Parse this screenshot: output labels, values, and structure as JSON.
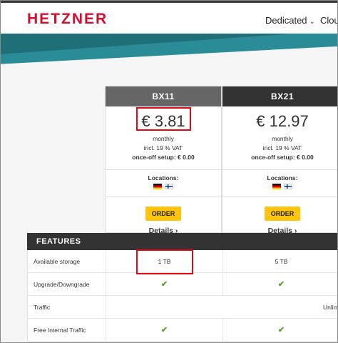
{
  "header": {
    "logo": "HETZNER",
    "nav": [
      {
        "label": "Dedicated",
        "chevron": "⌄"
      },
      {
        "label": "Clou"
      }
    ]
  },
  "products": [
    {
      "name": "BX11",
      "price": "€ 3.81",
      "period": "monthly",
      "vat": "incl. 19 % VAT",
      "setup": "once-off setup: € 0.00",
      "locations_label": "Locations:",
      "locations": [
        "germany-flag",
        "finland-flag"
      ],
      "order_label": "ORDER",
      "details_label": "Details",
      "details_arrow": "›"
    },
    {
      "name": "BX21",
      "price": "€ 12.97",
      "period": "monthly",
      "vat": "incl. 19 % VAT",
      "setup": "once-off setup: € 0.00",
      "locations_label": "Locations:",
      "locations": [
        "germany-flag",
        "finland-flag"
      ],
      "order_label": "ORDER",
      "details_label": "Details",
      "details_arrow": "›"
    }
  ],
  "features": {
    "title": "FEATURES",
    "rows": [
      {
        "label": "Available storage",
        "bx11": "1 TB",
        "bx21": "5 TB"
      },
      {
        "label": "Upgrade/Downgrade",
        "bx11": "✔",
        "bx21": "✔"
      },
      {
        "label": "Traffic",
        "shared": "Unlim"
      },
      {
        "label": "Free Internal Traffic",
        "bx11": "✔",
        "bx21": "✔"
      }
    ]
  },
  "colors": {
    "brand": "#d50c2d",
    "teal": "#1f6f79",
    "order_button": "#ffc40c",
    "highlight": "#e30613",
    "check": "#5aa22a"
  }
}
